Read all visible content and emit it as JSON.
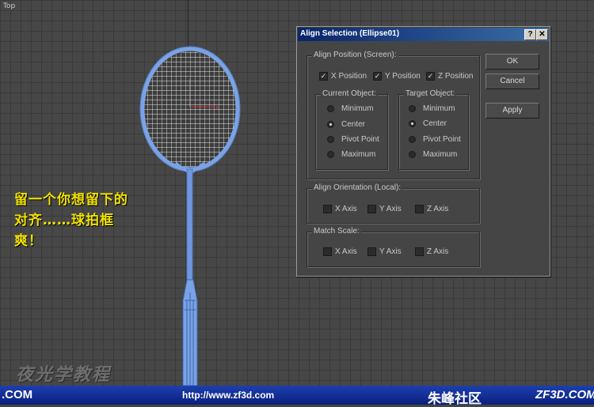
{
  "viewport": {
    "label": "Top"
  },
  "overlay": {
    "lines": [
      "留一个你想留下的",
      "对齐……球拍框",
      "爽！"
    ],
    "watermark": "夜光学教程"
  },
  "footer": {
    "left": ".COM",
    "url": "http://www.zf3d.com",
    "community": "朱峰社区",
    "domain": "ZF3D.COM"
  },
  "dialog": {
    "title": "Align Selection (Ellipse01)",
    "help_glyph": "?",
    "close_glyph": "✕",
    "align_position": {
      "label": "Align Position (Screen):",
      "x": {
        "label": "X Position",
        "checked": true
      },
      "y": {
        "label": "Y Position",
        "checked": true
      },
      "z": {
        "label": "Z Position",
        "checked": true
      }
    },
    "current_object": {
      "label": "Current Object:",
      "options": [
        "Minimum",
        "Center",
        "Pivot Point",
        "Maximum"
      ],
      "selected": "Center"
    },
    "target_object": {
      "label": "Target Object:",
      "options": [
        "Minimum",
        "Center",
        "Pivot Point",
        "Maximum"
      ],
      "selected": "Center"
    },
    "align_orientation": {
      "label": "Align Orientation (Local):",
      "x": "X Axis",
      "y": "Y Axis",
      "z": "Z Axis"
    },
    "match_scale": {
      "label": "Match Scale:",
      "x": "X Axis",
      "y": "Y Axis",
      "z": "Z Axis"
    },
    "buttons": {
      "ok": "OK",
      "cancel": "Cancel",
      "apply": "Apply"
    },
    "check_glyph": "✓"
  },
  "colors": {
    "racket": "#7aa3e6",
    "overlay_text": "#f2e200",
    "title_bar": "#0a246a"
  }
}
